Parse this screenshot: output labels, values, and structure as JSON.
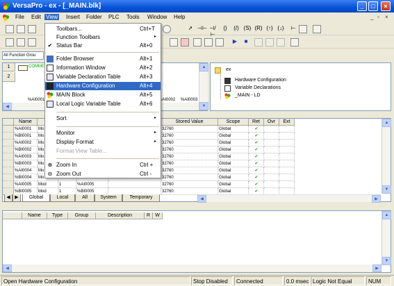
{
  "window": {
    "title": "VersaPro - ex - [_MAIN.blk]",
    "min": "_",
    "max": "□",
    "close": "×"
  },
  "menu": [
    {
      "label": "File"
    },
    {
      "label": "Edit"
    },
    {
      "label": "View"
    },
    {
      "label": "Insert"
    },
    {
      "label": "Folder"
    },
    {
      "label": "PLC"
    },
    {
      "label": "Tools"
    },
    {
      "label": "Window"
    },
    {
      "label": "Help"
    }
  ],
  "mdi_controls": {
    "min": "_",
    "restore": "▫",
    "close": "×"
  },
  "view_menu": [
    {
      "label": "Toolbars...",
      "shortcut": "Ctrl+T"
    },
    {
      "label": "Function Toolbars",
      "submenu": "▸"
    },
    {
      "label": "Status Bar",
      "shortcut": "Alt+0",
      "check": "✔"
    },
    {
      "label": "Folder Browser",
      "shortcut": "Alt+1"
    },
    {
      "label": "Information Window",
      "shortcut": "Alt+2"
    },
    {
      "label": "Variable Declaration Table",
      "shortcut": "Alt+3"
    },
    {
      "label": "Hardware Configuration",
      "shortcut": "Alt+4"
    },
    {
      "label": "MAIN Block",
      "shortcut": "Alt+5"
    },
    {
      "label": "Local Logic Variable Table",
      "shortcut": "Alt+6"
    },
    {
      "label": "Sort",
      "submenu": "▸"
    },
    {
      "label": "Monitor",
      "submenu": "▸"
    },
    {
      "label": "Display Format",
      "submenu": "▸"
    },
    {
      "label": "Format View Table..."
    },
    {
      "label": "Zoom In",
      "shortcut": "Ctrl +"
    },
    {
      "label": "Zoom Out",
      "shortcut": "Ctrl -"
    }
  ],
  "function_combo": "All Function Grou",
  "ladder": {
    "rows": [
      "1",
      "2"
    ],
    "comment_label": "COMMENT",
    "cell_labels": [
      "%AI0001",
      "%AI0002",
      "%AI0003"
    ]
  },
  "folder": {
    "root": "ex",
    "items": [
      "Hardware Configuration",
      "Variable Declarations",
      "_MAIN - LD"
    ]
  },
  "variable_table": {
    "headers": [
      "Name",
      "",
      "",
      "",
      "",
      "Stored Value",
      "Scope",
      "Ret",
      "Ovr",
      "Ext"
    ],
    "rows": [
      [
        "%AI0001",
        "Mo",
        "",
        "",
        "",
        "32760",
        "Global",
        "✔",
        "",
        ""
      ],
      [
        "%BI0001",
        "Mo",
        "",
        "",
        "",
        "32760",
        "Global",
        "✔",
        "",
        ""
      ],
      [
        "%AI0002",
        "Mo",
        "",
        "",
        "",
        "32760",
        "Global",
        "✔",
        "",
        ""
      ],
      [
        "%BI0002",
        "Mo",
        "",
        "",
        "",
        "32760",
        "Global",
        "✔",
        "",
        ""
      ],
      [
        "%AI0003",
        "Mo",
        "",
        "",
        "",
        "32760",
        "Global",
        "✔",
        "",
        ""
      ],
      [
        "%BI0003",
        "Mo",
        "",
        "",
        "",
        "32760",
        "Global",
        "✔",
        "",
        ""
      ],
      [
        "%AI0004",
        "Mo",
        "",
        "",
        "",
        "32760",
        "Global",
        "✔",
        "",
        ""
      ],
      [
        "%BI0004",
        "Mo",
        "",
        "",
        "",
        "32760",
        "Global",
        "✔",
        "",
        ""
      ],
      [
        "%AI0005",
        "Mod",
        "1",
        "%AI0005",
        "",
        "32760",
        "Global",
        "✔",
        "",
        ""
      ],
      [
        "%BI0005",
        "Mod",
        "1",
        "%BI0005",
        "",
        "32760",
        "Global",
        "✔",
        "",
        ""
      ]
    ]
  },
  "scope_tabs": [
    "Global",
    "Local",
    "All",
    "System",
    "Temporary"
  ],
  "lower_table": {
    "headers": [
      "Name",
      "Type",
      "Group",
      "Description",
      "R",
      "W"
    ]
  },
  "status": {
    "message": "Open Hardware Configuration",
    "plc": "Stop Disabled",
    "conn": "Connected",
    "sweep": "0.0 msec",
    "logic": "Logic Not Equal",
    "num": "NUM"
  }
}
